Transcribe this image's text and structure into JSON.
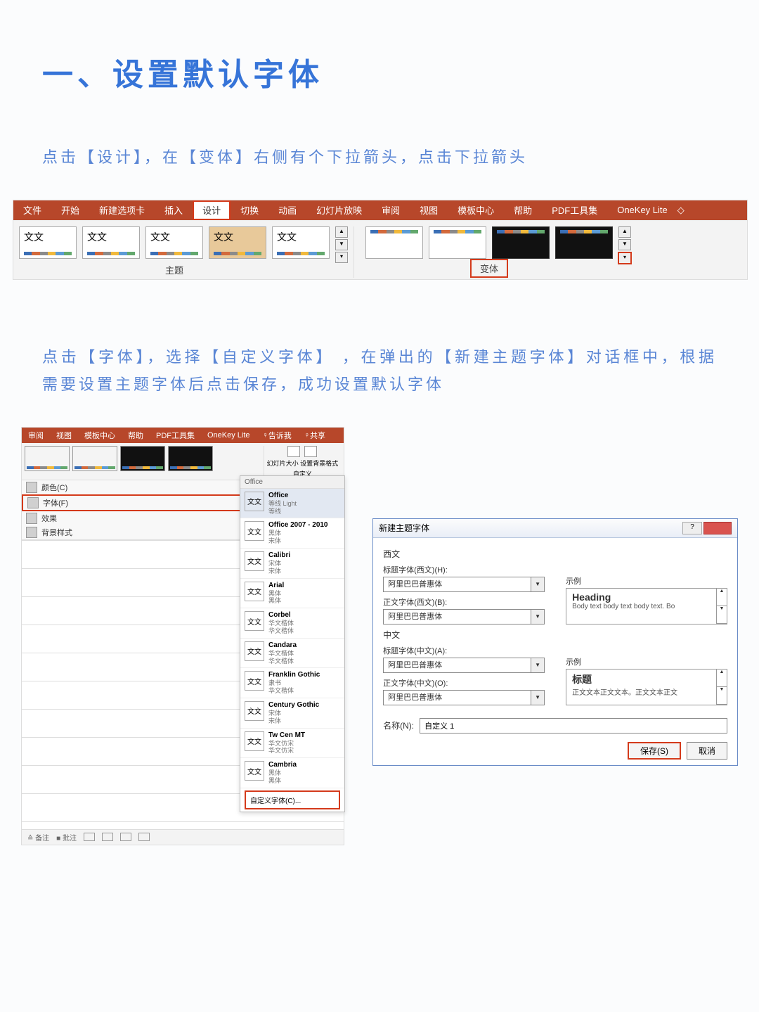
{
  "heading": "一、设置默认字体",
  "instruction1": "点击【设计】，在【变体】右侧有个下拉箭头，点击下拉箭头",
  "instruction2": "点击【字体】，选择【自定义字体】 ，在弹出的【新建主题字体】对话框中，根据需要设置主题字体后点击保存，成功设置默认字体",
  "ribbon1": {
    "tabs": [
      "文件",
      "开始",
      "新建选项卡",
      "插入",
      "设计",
      "切换",
      "动画",
      "幻灯片放映",
      "审阅",
      "视图",
      "模板中心",
      "帮助",
      "PDF工具集",
      "OneKey Lite"
    ],
    "active_tab_index": 4,
    "theme_thumb_text": "文文",
    "theme_label": "主题",
    "variant_label": "变体"
  },
  "ribbon2": {
    "tabs": [
      "审阅",
      "视图",
      "模板中心",
      "帮助",
      "PDF工具集",
      "OneKey Lite"
    ],
    "tell_me": "告诉我",
    "share": "共享",
    "slide_size": "幻灯片大小",
    "bg_format": "设置背景格式",
    "custom_label": "自定义",
    "menu_items": [
      {
        "label": "颜色(C)",
        "highlight": false
      },
      {
        "label": "字体(F)",
        "highlight": true
      },
      {
        "label": "效果",
        "highlight": false
      },
      {
        "label": "背景样式",
        "highlight": false
      }
    ]
  },
  "font_popup": {
    "header": "Office",
    "thumb": "文文",
    "items": [
      {
        "name": "Office",
        "sub1": "等线 Light",
        "sub2": "等线",
        "sel": true
      },
      {
        "name": "Office 2007 - 2010",
        "sub1": "黑体",
        "sub2": "宋体",
        "sel": false
      },
      {
        "name": "Calibri",
        "sub1": "宋体",
        "sub2": "宋体",
        "sel": false
      },
      {
        "name": "Arial",
        "sub1": "黑体",
        "sub2": "黑体",
        "sel": false
      },
      {
        "name": "Corbel",
        "sub1": "华文楷体",
        "sub2": "华文楷体",
        "sel": false
      },
      {
        "name": "Candara",
        "sub1": "华文楷体",
        "sub2": "华文楷体",
        "sel": false
      },
      {
        "name": "Franklin Gothic",
        "sub1": "隶书",
        "sub2": "华文楷体",
        "sel": false
      },
      {
        "name": "Century Gothic",
        "sub1": "宋体",
        "sub2": "宋体",
        "sel": false
      },
      {
        "name": "Tw Cen MT",
        "sub1": "华文仿宋",
        "sub2": "华文仿宋",
        "sel": false
      },
      {
        "name": "Cambria",
        "sub1": "黑体",
        "sub2": "黑体",
        "sel": false
      }
    ],
    "custom_fonts": "自定义字体(C)..."
  },
  "status_bar": {
    "notes": "备注",
    "comments": "批注"
  },
  "dialog": {
    "title": "新建主题字体",
    "section_latin": "西文",
    "label_heading_latin": "标题字体(西文)(H):",
    "label_body_latin": "正文字体(西文)(B):",
    "value_heading_latin": "阿里巴巴普惠体",
    "value_body_latin": "阿里巴巴普惠体",
    "sample_label": "示例",
    "sample_heading_latin": "Heading",
    "sample_body_latin": "Body text body text body text. Bo",
    "section_cjk": "中文",
    "label_heading_cjk": "标题字体(中文)(A):",
    "label_body_cjk": "正文字体(中文)(O):",
    "value_heading_cjk": "阿里巴巴普惠体",
    "value_body_cjk": "阿里巴巴普惠体",
    "sample_heading_cjk": "标题",
    "sample_body_cjk": "正文文本正文文本。正文文本正文",
    "name_label": "名称(N):",
    "name_value": "自定义 1",
    "save": "保存(S)",
    "cancel": "取消"
  }
}
